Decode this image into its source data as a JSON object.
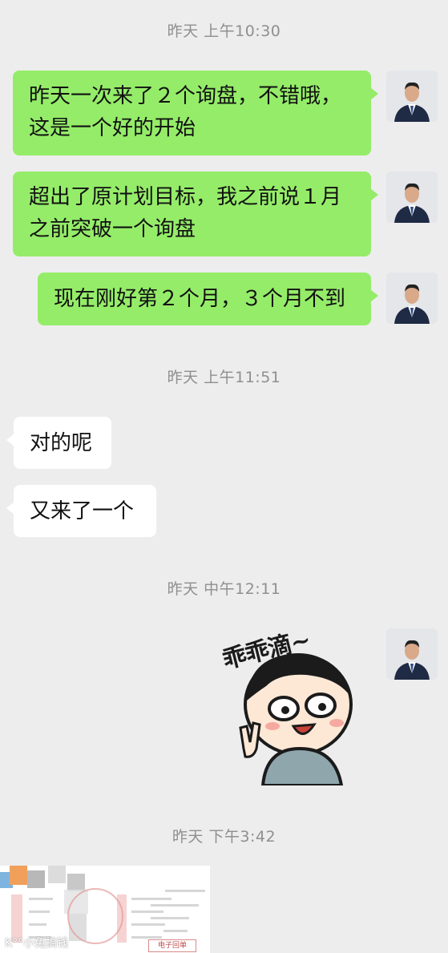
{
  "messages": {
    "ts1": "昨天 上午10:30",
    "m1_line1": "昨天一次来了２个询盘，不错哦，",
    "m1_line2": "这是一个好的开始",
    "m2_line1": "超出了原计划目标，我之前说１月",
    "m2_line2": "之前突破一个询盘",
    "m3": "现在刚好第２个月，３个月不到",
    "ts2": "昨天 上午11:51",
    "m4": "对的呢",
    "m5": "又来了一个",
    "ts3": "昨天 中午12:11",
    "sticker_text": "乖乖滴~",
    "ts4": "昨天 下午3:42"
  },
  "document_preview": {
    "title": "电子回单",
    "watermark": "K°°小兔搞钱"
  },
  "colors": {
    "background": "#ededed",
    "my_bubble": "#95ec69",
    "other_bubble": "#ffffff",
    "timestamp": "#8f8f8f"
  },
  "icons": {
    "avatar": "user-avatar-photo",
    "sticker": "cartoon-boy-sticker"
  }
}
